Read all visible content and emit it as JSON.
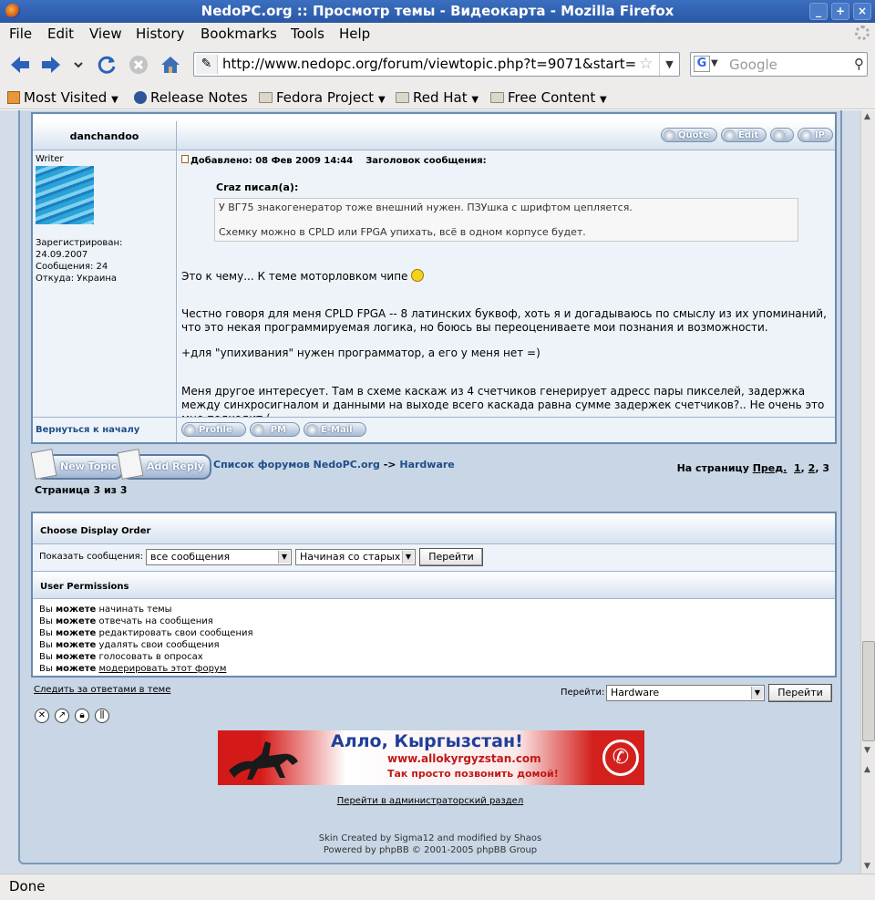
{
  "window": {
    "title": "NedoPC.org :: Просмотр темы - Видеокарта - Mozilla Firefox",
    "controls": [
      "_",
      "+",
      "×"
    ]
  },
  "menubar": [
    "File",
    "Edit",
    "View",
    "History",
    "Bookmarks",
    "Tools",
    "Help"
  ],
  "navbar": {
    "url": "http://www.nedopc.org/forum/viewtopic.php?t=9071&start=",
    "search_engine": "G",
    "search_placeholder": "Google"
  },
  "bookmarks": [
    "Most Visited",
    "Release Notes",
    "Fedora Project",
    "Red Hat",
    "Free Content"
  ],
  "post": {
    "author": "danchandoo",
    "rank": "Writer",
    "registered_label": "Зарегистрирован:",
    "registered_date": "24.09.2007",
    "posts": "Сообщения: 24",
    "location": "Откуда: Украина",
    "buttons": [
      "Quote",
      "Edit",
      "X",
      "IP"
    ],
    "posted_label": "Добавлено: 08 Фев 2009 14:44",
    "subject_label": "Заголовок сообщения:",
    "quote_author": "Craz писал(а):",
    "quote_line1": "У ВГ75 знакогенератор тоже внешний нужен. ПЗУшка с шрифтом цепляется.",
    "quote_line2": "Схемку можно в CPLD или FPGA упихать, всё в одном корпусе будет.",
    "para1": "Это к чему... К теме моторловком чипе",
    "para2": "Честно говоря для меня CPLD FPGA -- 8 латинских буквоф, хоть я и догадываюсь по смыслу из их упоминаний, что это некая программируемая логика, но боюсь вы переоцениваете мои познания и возможности.",
    "para3": "+для \"упихивания\" нужен программатор, а его у меня нет =)",
    "para4": "Меня другое интересует. Там в схеме каскаж из 4 счетчиков генерирует адресс пары пикселей, задержка между синхросигналом и данными на выходе всего каскада равна сумме задержек счетчиков?.. Не очень это мне подходит (",
    "back_to_top": "Вернуться к началу",
    "footer_buttons": [
      "Profile",
      "PM",
      "E-Mail"
    ]
  },
  "topic_nav": {
    "new_topic": "New Topic",
    "add_reply": "Add Reply",
    "forum_index": "Список форумов NedoPC.org",
    "arrow": "->",
    "forum": "Hardware",
    "pages_label": "На страницу",
    "prev": "Пред.",
    "page1": "1",
    "page2": "2",
    "page3": "3",
    "page_info": "Страница 3 из 3"
  },
  "display_order": {
    "header": "Choose Display Order",
    "show_label": "Показать сообщения:",
    "filter_value": "все сообщения",
    "order_value": "Начиная со старых",
    "go_label": "Перейти"
  },
  "permissions": {
    "header": "User Permissions",
    "prefix": "Вы",
    "can": "можете",
    "items": [
      "начинать темы",
      "отвечать на сообщения",
      "редактировать свои сообщения",
      "удалять свои сообщения",
      "голосовать в опросах",
      "модерировать этот форум"
    ]
  },
  "bottom": {
    "watch_topic": "Следить за ответами в теме",
    "jump_label": "Перейти:",
    "jump_value": "Hardware",
    "jump_go": "Перейти",
    "admin_link": "Перейти в администраторский раздел",
    "skin_credit": "Skin Created by Sigma12 and modified by Shaos",
    "powered": "Powered by phpBB © 2001-2005 phpBB Group"
  },
  "banner": {
    "headline": "Алло, Кыргызстан!",
    "url": "www.allokyrgyzstan.com",
    "slogan": "Так просто позвонить домой!"
  },
  "status": "Done",
  "colors": {
    "accent": "#1f4e87",
    "frame": "#c8d6e6",
    "banner_red": "#d3201c"
  }
}
